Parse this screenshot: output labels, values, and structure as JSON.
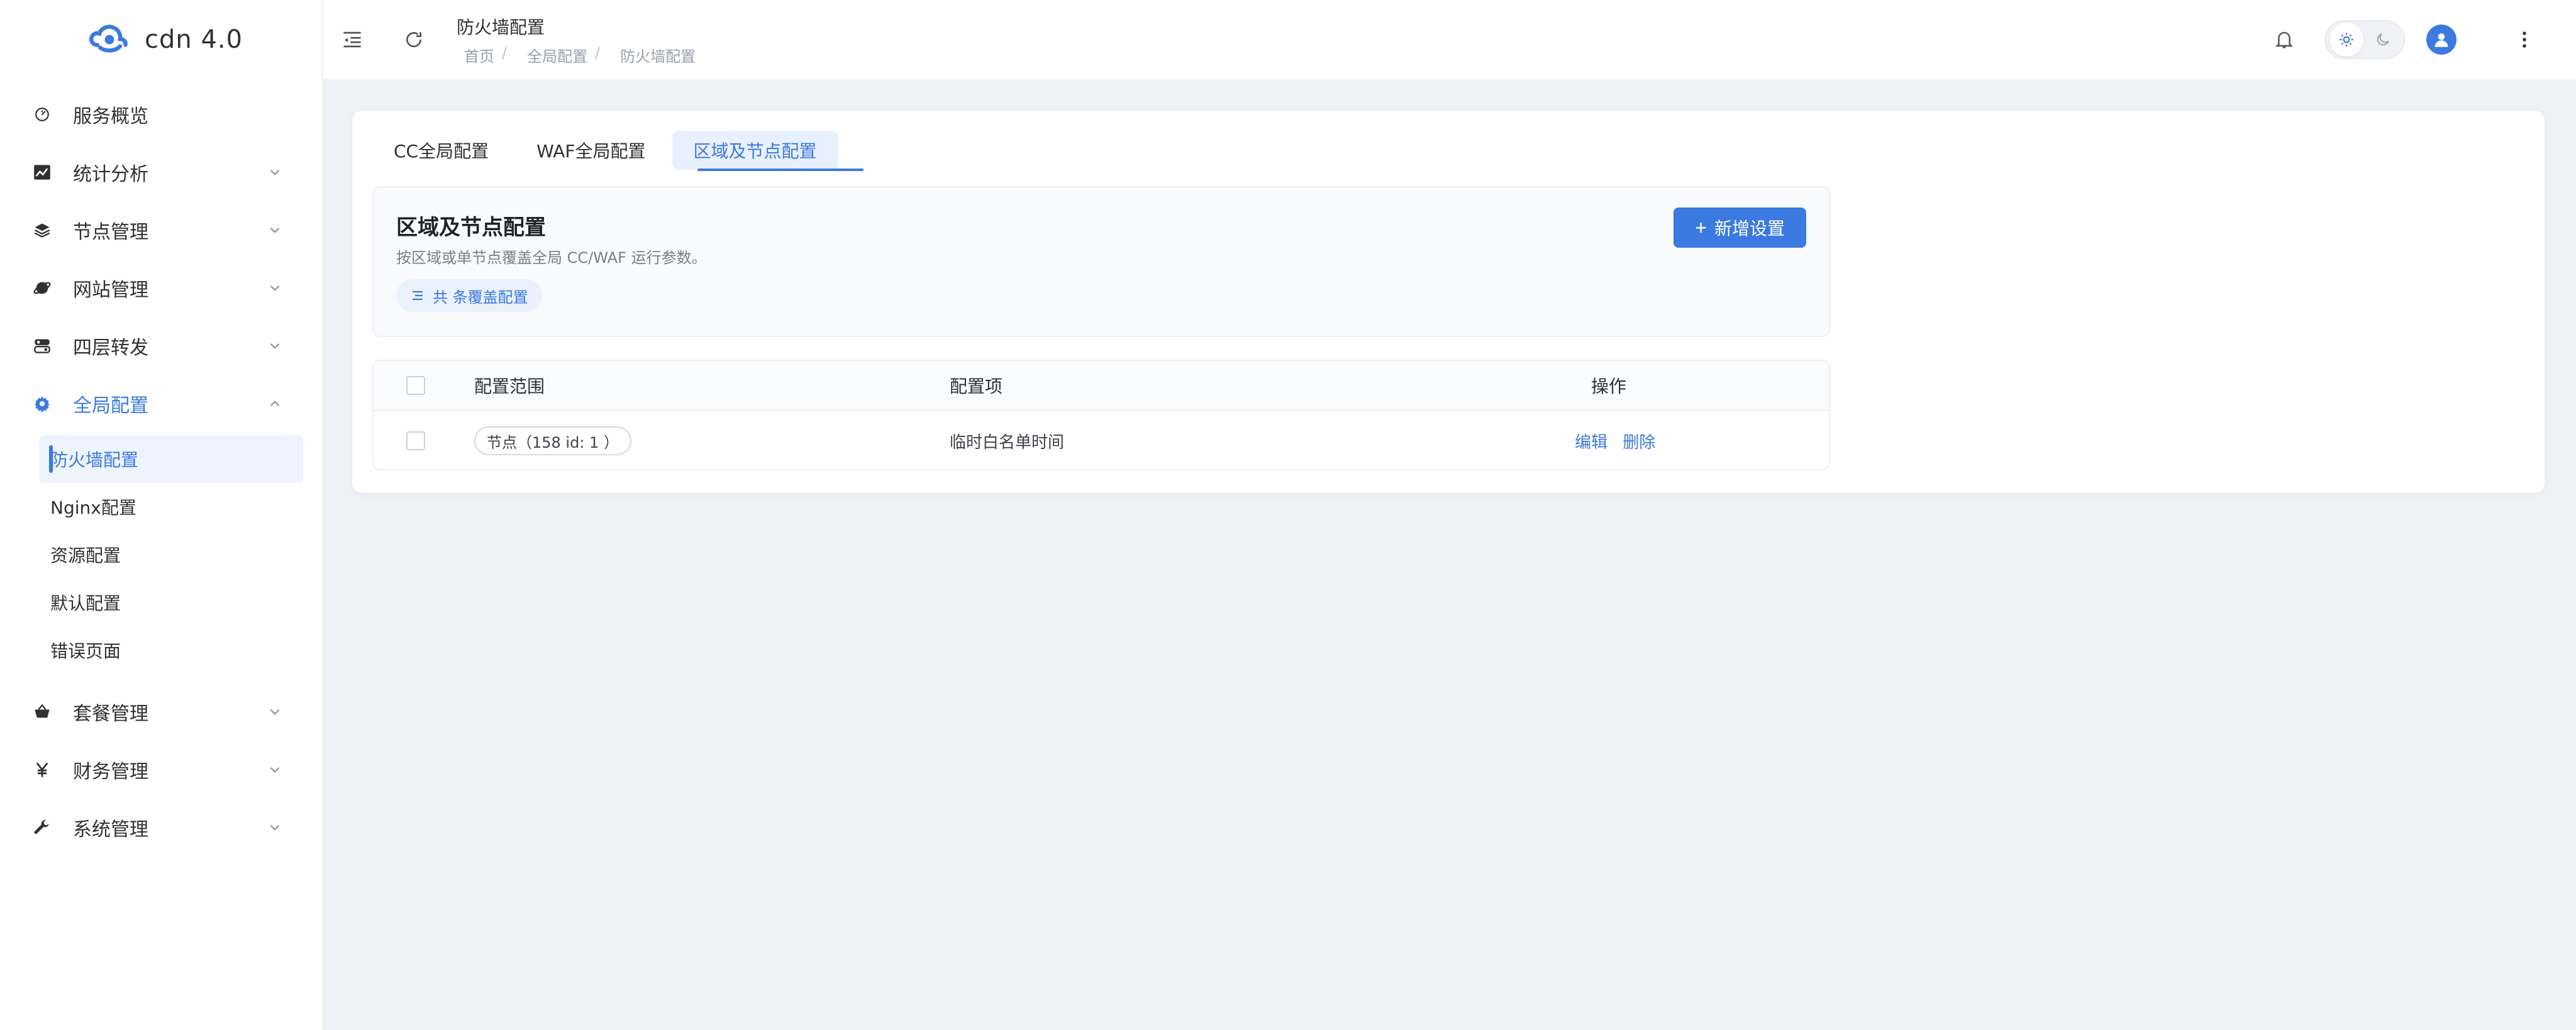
{
  "brand": {
    "name": "cdn 4.0"
  },
  "colors": {
    "accent": "#3b7ae0",
    "background": "#eef0f5",
    "sidebar": "#ffffff"
  },
  "sidebar": {
    "items": [
      {
        "label": "服务概览",
        "icon": "dashboard-icon",
        "expandable": false
      },
      {
        "label": "统计分析",
        "icon": "chart-icon",
        "expandable": true
      },
      {
        "label": "节点管理",
        "icon": "layers-icon",
        "expandable": true
      },
      {
        "label": "网站管理",
        "icon": "globe-icon",
        "expandable": true
      },
      {
        "label": "四层转发",
        "icon": "forward-icon",
        "expandable": true
      },
      {
        "label": "全局配置",
        "icon": "gear-icon",
        "expandable": true,
        "active": true,
        "children": [
          "防火墙配置",
          "Nginx配置",
          "资源配置",
          "默认配置",
          "错误页面"
        ]
      },
      {
        "label": "套餐管理",
        "icon": "basket-icon",
        "expandable": true
      },
      {
        "label": "财务管理",
        "icon": "yen-icon",
        "expandable": true
      },
      {
        "label": "系统管理",
        "icon": "wrench-icon",
        "expandable": true
      }
    ]
  },
  "header": {
    "title": "防火墙配置",
    "breadcrumb": [
      "首页",
      "全局配置",
      "防火墙配置"
    ],
    "icons": [
      "menu-fold-icon",
      "refresh-icon",
      "bell-icon",
      "sun-icon",
      "moon-icon",
      "user-icon",
      "more-vertical-icon"
    ]
  },
  "tabs": [
    "CC全局配置",
    "WAF全局配置",
    "区域及节点配置"
  ],
  "active_tab": "区域及节点配置",
  "section": {
    "title": "区域及节点配置",
    "description": "按区域或单节点覆盖全局 CC/WAF 运行参数。",
    "count_chip": "共 条覆盖配置",
    "add_button": "新增设置"
  },
  "table": {
    "headers": [
      "配置范围",
      "配置项",
      "操作"
    ],
    "rows": [
      {
        "scope": "节点（158 id: 1 ）",
        "item": "临时白名单时间",
        "actions": [
          "编辑",
          "删除"
        ]
      }
    ]
  }
}
